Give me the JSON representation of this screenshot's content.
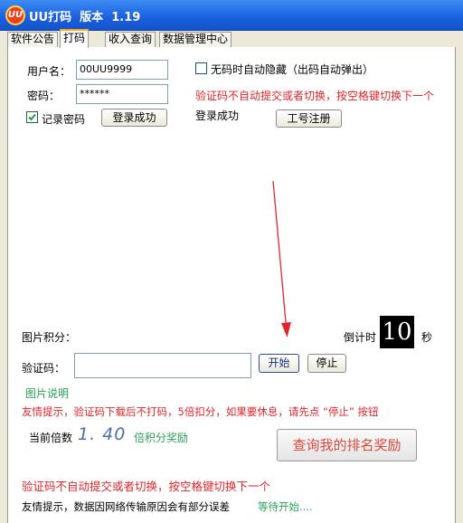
{
  "window": {
    "title": "UU打码  版本  1.19",
    "logo_text": "UU"
  },
  "tabs": [
    {
      "label": "软件公告"
    },
    {
      "label": "打码"
    },
    {
      "label": "收入查询"
    },
    {
      "label": "数据管理中心"
    }
  ],
  "login": {
    "username_label": "用户名：",
    "username_value": "00UU9999",
    "password_label": "密码：",
    "password_value": "******",
    "remember_label": "记录密码",
    "remember_checked": true,
    "login_button": "登录成功",
    "status_text": "登录成功",
    "register_button": "工号注册"
  },
  "options": {
    "auto_hide_label": "无码时自动隐藏（出码自动弹出）",
    "auto_hide_checked": false,
    "hint_top": "验证码不自动提交或者切换，按空格键切换下一个"
  },
  "captcha": {
    "score_label": "图片积分：",
    "countdown_label": "倒计时",
    "countdown_value": "10",
    "seconds_label": "秒",
    "code_label": "验证码：",
    "code_value": "",
    "start_button": "开始",
    "stop_button": "停止",
    "image_help_link": "图片说明"
  },
  "notices": {
    "friendly_tip": "友情提示，验证码下载后不打码，5倍扣分，如果要休息，请先点 “停止” 按钮",
    "multiplier_label": "当前倍数",
    "multiplier_value": "1. 40",
    "multiplier_suffix": "倍积分奖励",
    "rank_button": "查询我的排名奖励",
    "hint_bottom": "验证码不自动提交或者切换，按空格键切换下一个",
    "network_tip": "友情提示，数据因网络传输原因会有部分误差",
    "waiting_status": "等待开始...."
  },
  "colors": {
    "accent_red": "#e0262b",
    "accent_green": "#2aa05a",
    "title_blue": "#1a5fe0"
  }
}
